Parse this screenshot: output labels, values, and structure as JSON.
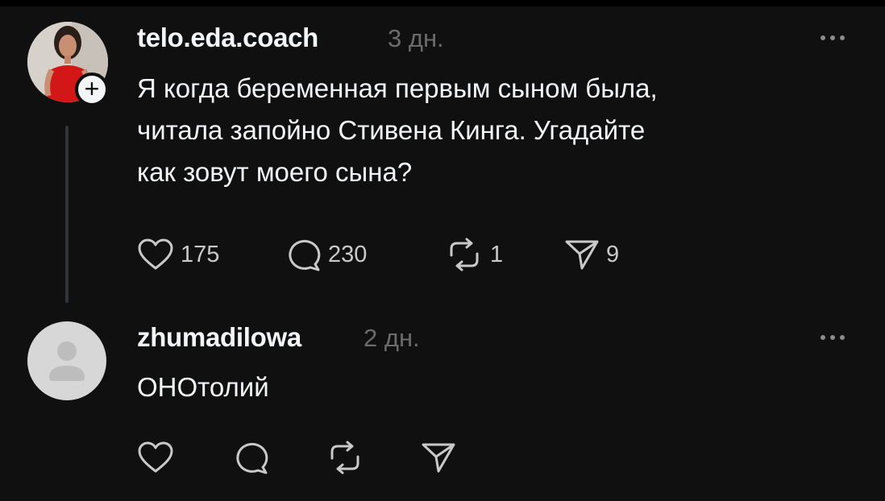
{
  "post": {
    "username": "telo.eda.coach",
    "time": "3 дн.",
    "text_lines": [
      "Я когда беременная первым сыном была,",
      "читала запойно Стивена Кинга. Угадайте",
      "как зовут моего сына?"
    ],
    "likes": "175",
    "comments": "230",
    "reposts": "1",
    "shares": "9"
  },
  "reply": {
    "username": "zhumadilowa",
    "time": "2 дн.",
    "text": "ОНОтолий"
  },
  "icons": {
    "like": "heart-icon",
    "comment": "comment-bubble-icon",
    "repost": "repost-icon",
    "share": "send-icon",
    "more": "more-dots-icon"
  },
  "colors": {
    "background": "#101010",
    "text": "#f3f5f7",
    "muted": "#6b6b6b"
  }
}
